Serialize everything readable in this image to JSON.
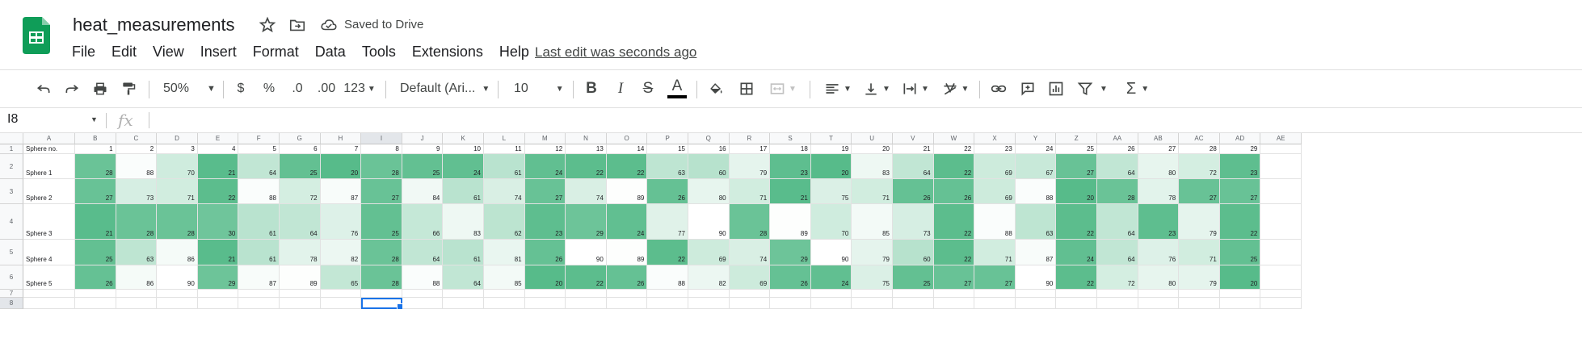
{
  "app": {
    "doc_title": "heat_measurements",
    "saved_status": "Saved to Drive",
    "last_edit": "Last edit was seconds ago",
    "brand_color": "#0f9d58"
  },
  "menu": [
    "File",
    "Edit",
    "View",
    "Insert",
    "Format",
    "Data",
    "Tools",
    "Extensions",
    "Help"
  ],
  "toolbar": {
    "zoom": "50%",
    "currency": "$",
    "percent": "%",
    "decrease_decimal": ".0",
    "increase_decimal": ".00",
    "number_format": "123",
    "font": "Default (Ari...",
    "font_size": "10",
    "bold": "B",
    "italic": "I",
    "strikethrough": "S",
    "text_color": "A",
    "text_color_value": "#000000"
  },
  "formula_bar": {
    "name_box": "I8",
    "fx": "fx",
    "value": ""
  },
  "grid": {
    "columns": [
      "A",
      "B",
      "C",
      "D",
      "E",
      "F",
      "G",
      "H",
      "I",
      "J",
      "K",
      "L",
      "M",
      "N",
      "O",
      "P",
      "Q",
      "R",
      "S",
      "T",
      "U",
      "V",
      "W",
      "X",
      "Y",
      "Z",
      "AA",
      "AB",
      "AC",
      "AD",
      "AE"
    ],
    "row_numbers": [
      "1",
      "2",
      "3",
      "4",
      "5",
      "6",
      "7",
      "8"
    ],
    "header_row": [
      "Sphere no.",
      "1",
      "2",
      "3",
      "4",
      "5",
      "6",
      "7",
      "8",
      "9",
      "10",
      "11",
      "12",
      "13",
      "14",
      "15",
      "16",
      "17",
      "18",
      "19",
      "20",
      "21",
      "22",
      "23",
      "24",
      "25",
      "26",
      "27",
      "28",
      "29",
      ""
    ],
    "row_labels": [
      "Sphere 1",
      "Sphere 2",
      "Sphere 3",
      "Sphere 4",
      "Sphere 5"
    ],
    "values": [
      [
        28,
        88,
        70,
        21,
        64,
        25,
        20,
        28,
        25,
        24,
        61,
        24,
        22,
        22,
        63,
        60,
        79,
        23,
        20,
        83,
        64,
        22,
        69,
        67,
        27,
        64,
        80,
        72,
        23
      ],
      [
        27,
        73,
        71,
        22,
        88,
        72,
        87,
        27,
        84,
        61,
        74,
        27,
        74,
        89,
        26,
        80,
        71,
        21,
        75,
        71,
        26,
        26,
        69,
        88,
        20,
        28,
        78,
        27,
        27
      ],
      [
        21,
        28,
        28,
        30,
        61,
        64,
        76,
        25,
        66,
        83,
        62,
        23,
        29,
        24,
        77,
        90,
        28,
        89,
        70,
        85,
        73,
        22,
        88,
        63,
        22,
        64,
        23,
        79,
        22
      ],
      [
        25,
        63,
        86,
        21,
        61,
        78,
        82,
        28,
        64,
        61,
        81,
        26,
        90,
        89,
        22,
        69,
        74,
        29,
        90,
        79,
        60,
        22,
        71,
        87,
        24,
        64,
        76,
        71,
        25
      ],
      [
        26,
        86,
        90,
        29,
        87,
        89,
        65,
        28,
        88,
        64,
        85,
        20,
        22,
        26,
        88,
        82,
        69,
        26,
        24,
        75,
        25,
        27,
        27,
        90,
        22,
        72,
        80,
        79,
        20
      ]
    ],
    "selected_cell": "I8",
    "heat_low_color": "#57bb8a",
    "heat_high_color": "#ffffff",
    "selection_color": "#1a73e8"
  }
}
